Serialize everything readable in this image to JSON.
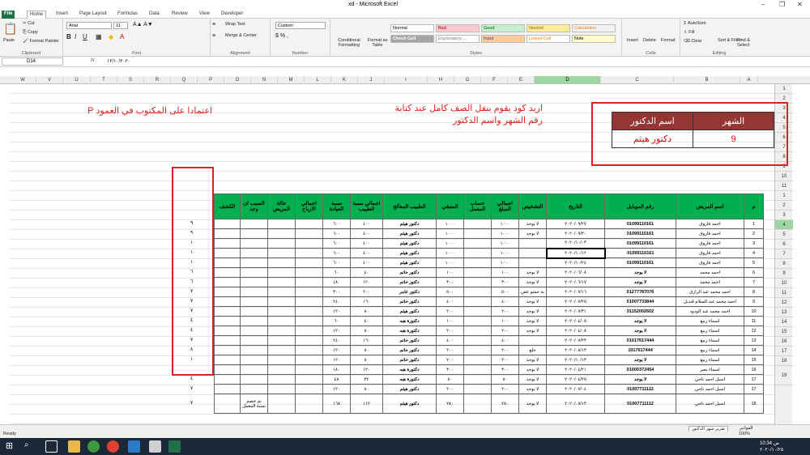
{
  "window": {
    "title": "xd - Microsoft Excel"
  },
  "tabs": [
    "File",
    "Home",
    "Insert",
    "Page Layout",
    "Formulas",
    "Data",
    "Review",
    "View",
    "Developer"
  ],
  "ribbon": {
    "clipboard": {
      "paste": "Paste",
      "cut": "Cut",
      "copy": "Copy",
      "format_painter": "Format Painter",
      "label": "Clipboard"
    },
    "font": {
      "name": "Arial",
      "size": "11",
      "label": "Font"
    },
    "alignment": {
      "wrap": "Wrap Text",
      "merge": "Merge & Center",
      "label": "Alignment"
    },
    "number": {
      "format": "Custom",
      "label": "Number"
    },
    "styles": {
      "conditional": "Conditional Formatting",
      "format_table": "Format as Table",
      "normal": "Normal",
      "bad": "Bad",
      "good": "Good",
      "neutral": "Neutral",
      "calculation": "Calculation",
      "check": "Check Cell",
      "explanatory": "Explanatory ...",
      "input": "Input",
      "linked": "Linked Cell",
      "note": "Note",
      "label": "Styles"
    },
    "cells": {
      "insert": "Insert",
      "delete": "Delete",
      "format": "Format",
      "label": "Cells"
    },
    "editing": {
      "autosum": "AutoSum",
      "fill": "Fill",
      "clear": "Clear",
      "sort": "Sort & Filter",
      "find": "Find & Select",
      "label": "Editing"
    }
  },
  "formula_bar": {
    "name_box": "D14",
    "fx": "fx",
    "value": "١٢/١٠/٢٠٢٠"
  },
  "columns": [
    "W",
    "V",
    "U",
    "T",
    "S",
    "R",
    "Q",
    "P",
    "O",
    "N",
    "M",
    "L",
    "K",
    "J",
    "I",
    "H",
    "G",
    "F",
    "E",
    "D",
    "C",
    "B",
    "A"
  ],
  "rows": [
    "1",
    "2",
    "3",
    "4",
    "5",
    "6",
    "7",
    "8",
    "9",
    "10",
    "11",
    "1",
    "2",
    "3",
    "4",
    "5",
    "6",
    "7",
    "8",
    "9",
    "10",
    "11",
    "12",
    "13",
    "14",
    "15",
    "16",
    "17",
    "18",
    "19"
  ],
  "notes": {
    "left": "اعتمادا على المكتوب في العمود P",
    "middle": "اريد كود يقوم بنقل الصف كامل عند كتابة رقم الشهر واسم الدكتور"
  },
  "month_table": {
    "h_month": "الشهر",
    "h_doctor": "اسم الدكتور",
    "month": "9",
    "doctor": "دكتور هيثم"
  },
  "headers": [
    "الكشف",
    "السبب ان وجد",
    "حالة المريض",
    "اجمالي الارباح",
    "نسبة العيادة",
    "اجمالي نسبة الطبيب",
    "الطبيب المعالج",
    "المتبقي",
    "حساب المعمل",
    "اجمالي المبلغ",
    "التشخيص",
    "التاريخ",
    "رقم الموبايل",
    "اسم المريض",
    "م"
  ],
  "p_values": [
    "٩",
    "٩",
    "١٠",
    "١٠",
    "١٠",
    "٦",
    "٦",
    "٧",
    "٧",
    "٧",
    "٤",
    "٤",
    "٧",
    "٨",
    "١٠",
    "",
    "٤",
    "٧",
    "٧"
  ],
  "rows_data": [
    [
      "",
      "",
      "",
      "",
      "٦٠٠",
      "٤٠٠",
      "دكتور هيثم",
      "١٠٠٠",
      "",
      "١٠٠٠",
      "لا يوجد",
      "٢٠٢٠/٠٩/٢٧",
      "01099110161",
      "احمد فاروق",
      "1"
    ],
    [
      "",
      "",
      "",
      "",
      "٦٠٠",
      "٤٠٠",
      "دكتور هيثم",
      "١٠٠٠",
      "",
      "١٠٠٠",
      "لا يوجد",
      "٢٠٢٠/٠٩/٣٠",
      "01099110161",
      "احمد فاروق",
      "2"
    ],
    [
      "",
      "",
      "",
      "",
      "٦٠٠",
      "٤٠٠",
      "دكتور هيثم",
      "١٠٠٠",
      "",
      "١٠٠٠",
      "",
      "٢٠٢٠/١٠/٠٣",
      "01099110161",
      "احمد فاروق",
      "3"
    ],
    [
      "",
      "",
      "",
      "",
      "٦٠٠",
      "٤٠٠",
      "دكتور هيثم",
      "١٠٠٠",
      "",
      "١٠٠٠",
      "",
      "٢٠٢٠/١٠/١٢",
      "01099110161",
      "احمد فاروق",
      "4"
    ],
    [
      "",
      "",
      "",
      "",
      "٦٠٠",
      "٤٠٠",
      "دكتور هيثم",
      "١٠٠٠",
      "",
      "١٠٠٠",
      "",
      "٢٠٢٠/١٠/٢٤",
      "01099110161",
      "احمد فاروق",
      "5"
    ],
    [
      "",
      "",
      "",
      "",
      "٦٠",
      "٤٠",
      "دكتور حاتم",
      "١٠٠",
      "",
      "١٠٠",
      "لا يوجد",
      "٢٠٢٠/٠٦/٠٨",
      "لا يوجد",
      "احمد محمد",
      "6"
    ],
    [
      "",
      "",
      "",
      "",
      "١٨٠",
      "١٢٠",
      "دكتور حاتم",
      "٣٠٠",
      "",
      "٣٠٠",
      "لا يوجد",
      "٢٠٢٠/٠٦/١٧",
      "لا يوجد",
      "احمد محمد",
      "7"
    ],
    [
      "",
      "",
      "",
      "",
      "٣٠٠",
      "٢٠٠",
      "دكتور عامر",
      "٥٠٠",
      "",
      "٥٠٠",
      "ية حشو عص",
      "٢٠٢٠/٠٧/١٦",
      "01277787076",
      "احمد محمد عبد الرازق",
      "8"
    ],
    [
      "",
      "",
      "",
      "",
      "٢٤٠",
      "١٦٠",
      "دكتور حاتم",
      "٤٠٠",
      "",
      "٤٠٠",
      "لا يوجد",
      "٢٠٢٠/٠٧/٢٥",
      "01007733844",
      "احمد محمد عبد السلام قنديل",
      "9"
    ],
    [
      "",
      "",
      "",
      "",
      "١٢٠",
      "٨٠",
      "دكتور هيثم",
      "٢٠٠",
      "",
      "٢٠٠",
      "لا يوجد",
      "٢٠٢٠/٠٧/٣١",
      "01152002602",
      "احمد محمد عبد الودود",
      "10"
    ],
    [
      "",
      "",
      "",
      "",
      "٦٠",
      "٤٠",
      "دكتورة هبه",
      "١٠٠",
      "",
      "١٠٠",
      "لا يوجد",
      "٢٠٢٠/٠٤/٠٥",
      "لا يوجد",
      "اسماء ربيع",
      "11"
    ],
    [
      "",
      "",
      "",
      "",
      "١٢٠",
      "٨٠",
      "دكتورة هبه",
      "٢٠٠",
      "",
      "٢٠٠",
      "لا يوجد",
      "٢٠٢٠/٠٤/٠٨",
      "لا يوجد",
      "اسماء ربيع",
      "12"
    ],
    [
      "",
      "",
      "",
      "",
      "٢٤٠",
      "١٦٠",
      "دكتور حاتم",
      "٤٠٠",
      "",
      "٤٠٠",
      "",
      "٢٠٢٠/٠٧/٢٣",
      "01017617444",
      "اسماء ربيع",
      "13"
    ],
    [
      "",
      "",
      "",
      "",
      "١٢٠",
      "٨٠",
      "دكتور حاتم",
      "٢٠٠",
      "",
      "٢٠٠",
      "خلع",
      "٢٠٢٠/٠٨/١٣",
      "1017617444",
      "اسماء ربيع",
      "14"
    ],
    [
      "",
      "",
      "",
      "",
      "١٢٠",
      "٨٠",
      "دكتور حاتم",
      "٢٠٠",
      "",
      "٢٠٠",
      "لا يوجد",
      "٢٠٢٠/١٠/١٣",
      "لا يوجد",
      "اسماء ربيع",
      "15"
    ],
    [
      "",
      "",
      "",
      "",
      "١٨٠",
      "١٢٠",
      "دكتورة هبه",
      "٣٠٠",
      "",
      "٣٠٠",
      "لا يوجد",
      "٢٠٢٠/٠٤/٢١",
      "01000372454",
      "اسماء نصر",
      "16"
    ],
    [
      "",
      "",
      "",
      "",
      "٤٨",
      "٣٢",
      "دكتورة هبه",
      "٨٠",
      "",
      "٨٠",
      "لا يوجد",
      "٢٠٢٠/٠٤/٢٥",
      "لا يوجد",
      "اسيل احمد ناجي",
      "17"
    ],
    [
      "",
      "",
      "",
      "",
      "١٢٠",
      "٨٠",
      "دكتور هيثم",
      "٢٠٠",
      "",
      "٢٠٠",
      "لا يوجد",
      "٢٠٢٠/٠٧/٠٤",
      "01007711112",
      "اسيل احمد ناجي",
      "17"
    ],
    [
      "",
      "تم خصم نسبة المعمل",
      "",
      "",
      "١٦٨",
      "١١٢",
      "دكتور هيثم",
      "٢٨٠",
      "",
      "٢٨٠",
      "لا يوجد",
      "٢٠٢٠/٠٧/١٣",
      "01007711112",
      "اسيل احمد ناجي",
      "18"
    ]
  ],
  "sheet_tabs": [
    "الفواتير",
    "تقرير شهر الدكتور"
  ],
  "status": {
    "ready": "Ready",
    "zoom": "100%"
  },
  "clock": {
    "time": "10:34 ص",
    "date": "٢٠٢٠/١٠/٢٥"
  },
  "colors": {
    "header_green": "#00b04f",
    "month_header": "#963634",
    "accent_red": "#e02020",
    "excel_green": "#1f7246"
  }
}
